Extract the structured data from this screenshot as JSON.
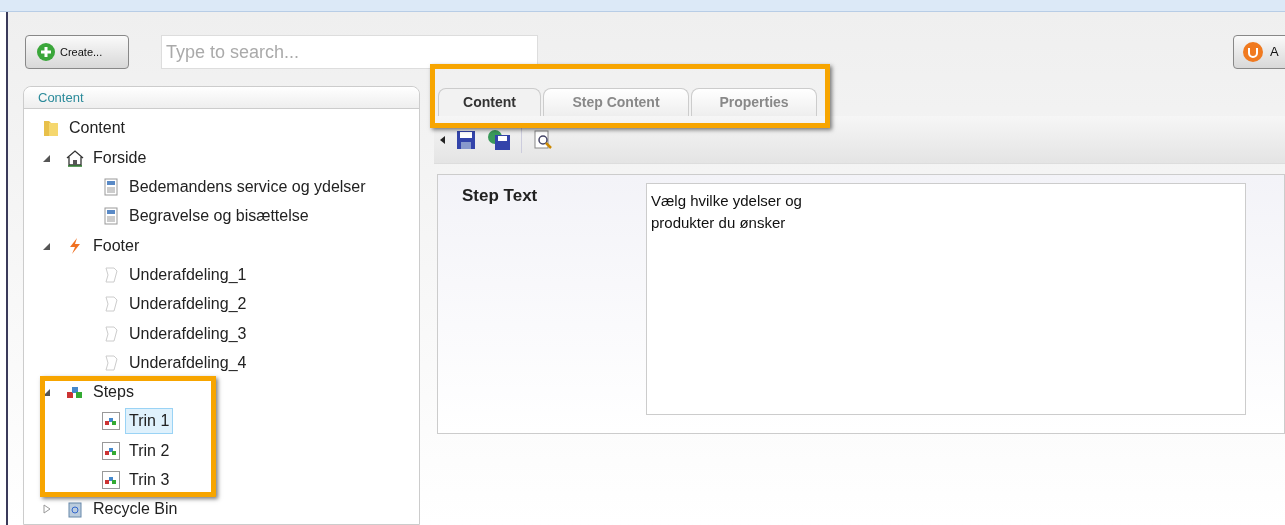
{
  "toolbar": {
    "create_button": "Create...",
    "search": {
      "placeholder": "Type to search..."
    },
    "right_button": "A"
  },
  "content_panel": {
    "title": "Content",
    "tree": [
      {
        "label": "Content",
        "kind": "folder",
        "selected": false,
        "children": [
          {
            "label": "Forside",
            "kind": "home",
            "expanded": true,
            "selected": false,
            "children": [
              {
                "label": "Bedemandens service og ydelser",
                "kind": "page",
                "selected": false
              },
              {
                "label": "Begravelse og bisættelse",
                "kind": "page",
                "selected": false
              }
            ]
          },
          {
            "label": "Footer",
            "kind": "lightning",
            "expanded": true,
            "selected": false,
            "children": [
              {
                "label": "Underafdeling_1",
                "kind": "blank",
                "selected": false
              },
              {
                "label": "Underafdeling_2",
                "kind": "blank",
                "selected": false
              },
              {
                "label": "Underafdeling_3",
                "kind": "blank",
                "selected": false
              },
              {
                "label": "Underafdeling_4",
                "kind": "blank",
                "selected": false
              }
            ]
          },
          {
            "label": "Steps",
            "kind": "steps",
            "expanded": true,
            "selected": false,
            "children": [
              {
                "label": "Trin 1",
                "kind": "step",
                "selected": true
              },
              {
                "label": "Trin 2",
                "kind": "step",
                "selected": false
              },
              {
                "label": "Trin 3",
                "kind": "step",
                "selected": false
              }
            ]
          },
          {
            "label": "Recycle Bin",
            "kind": "bin",
            "expanded": false,
            "selected": false
          }
        ]
      }
    ]
  },
  "tabs": [
    {
      "label": "Content",
      "selected": true
    },
    {
      "label": "Step Content",
      "selected": false
    },
    {
      "label": "Properties",
      "selected": false
    }
  ],
  "form": {
    "field_label": "Step Text",
    "value": "Vælg hvilke ydelser og\nprodukter du ønsker"
  }
}
